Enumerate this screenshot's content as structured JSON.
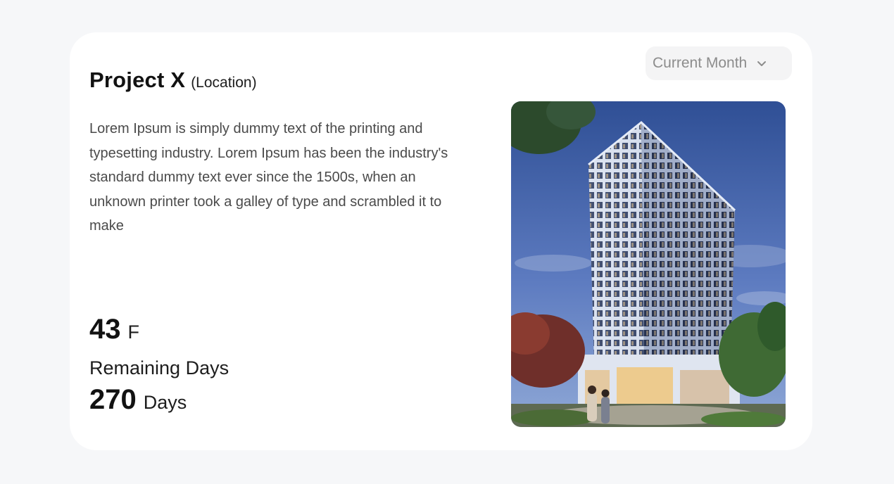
{
  "project": {
    "name": "Project X",
    "location": "(Location)"
  },
  "description": "Lorem Ipsum is simply dummy text of the printing and typesetting industry. Lorem Ipsum has been the industry's standard dummy text ever since the 1500s, when an unknown printer took a galley of type and scrambled it to make",
  "temperature": {
    "value": "43",
    "unit": "F"
  },
  "remaining": {
    "label": "Remaining Days",
    "value": "270",
    "unit": "Days"
  },
  "period_filter": {
    "selected": "Current Month",
    "icon": "chevron-down-icon"
  },
  "image": {
    "subject": "building-photo"
  },
  "colors": {
    "background": "#f6f7f9",
    "card": "#ffffff",
    "dropdown_bg": "#f4f4f5",
    "dropdown_text": "#8c8c8c"
  }
}
